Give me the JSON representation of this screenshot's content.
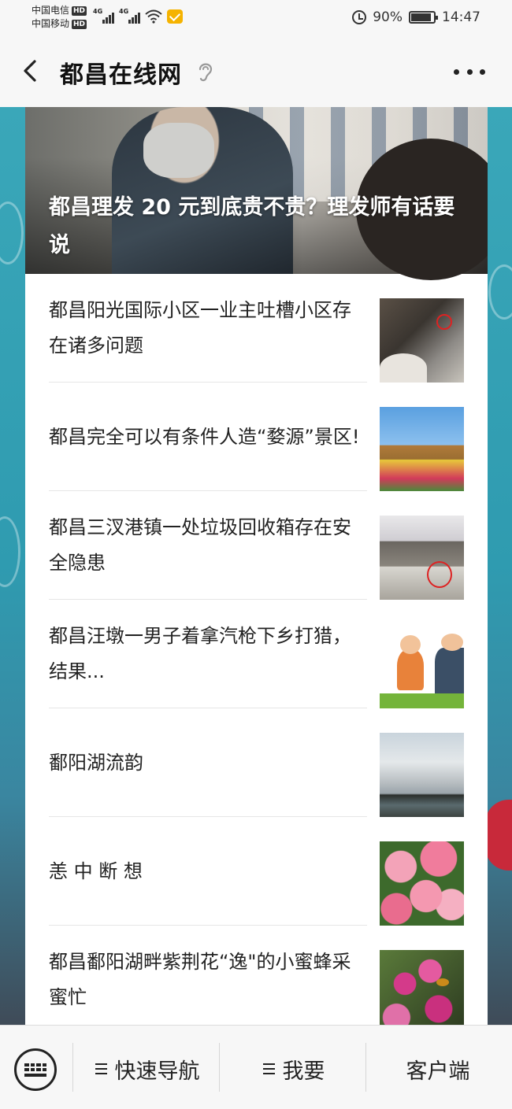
{
  "status_bar": {
    "carrier_1": "中国电信",
    "carrier_2": "中国移动",
    "hd_badge": "HD",
    "network_1": "4G",
    "network_2": "4G",
    "battery": "90%",
    "battery_level": 0.9,
    "time": "14:47",
    "icons": [
      "signal-icon",
      "wifi-icon",
      "mail-icon",
      "alarm-icon",
      "battery-icon"
    ]
  },
  "header": {
    "title": "都昌在线网",
    "back_icon": "chevron-left-icon",
    "ear_icon": "ear-icon",
    "more_icon": "more-dots-icon"
  },
  "hero": {
    "title": "都昌理发 20 元到底贵不贵？理发师有话要说"
  },
  "articles": [
    {
      "title": "都昌阳光国际小区一业主吐槽小区存在诸多问题"
    },
    {
      "title": "都昌完全可以有条件人造“婺源”景区!"
    },
    {
      "title": "都昌三汊港镇一处垃圾回收箱存在安全隐患"
    },
    {
      "title": "都昌汪墩一男子着拿汽枪下乡打猎，结果..."
    },
    {
      "title": "鄱阳湖流韵"
    },
    {
      "title": "恙 中 断 想"
    },
    {
      "title": "都昌鄱阳湖畔紫荆花“逸\"的小蜜蜂采蜜忙"
    }
  ],
  "bottom_bar": {
    "nav_label": "快速导航",
    "want_label": "我要",
    "client_label": "客户端",
    "keyboard_icon": "keyboard-icon",
    "menu_icon": "menu-icon"
  },
  "colors": {
    "background_teal": "#3aa7b9",
    "card": "#ffffff",
    "text": "#222222"
  }
}
